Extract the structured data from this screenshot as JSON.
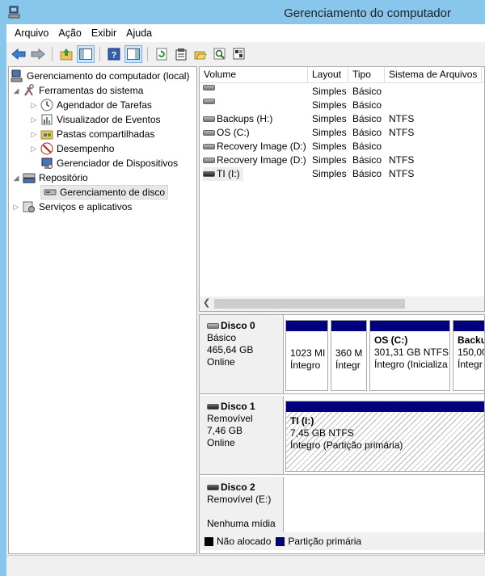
{
  "window": {
    "title": "Gerenciamento do computador"
  },
  "menu": [
    "Arquivo",
    "Ação",
    "Exibir",
    "Ajuda"
  ],
  "toolbar": {
    "icons": [
      "back-arrow-icon",
      "forward-arrow-icon",
      "up-folder-icon",
      "show-hide-tree-icon",
      "help-icon",
      "properties-pane-icon",
      "refresh-icon",
      "properties-icon",
      "open-icon",
      "search-icon",
      "settings-icon"
    ]
  },
  "tree": {
    "root": "Gerenciamento do computador (local)",
    "tools": "Ferramentas do sistema",
    "scheduler": "Agendador de Tarefas",
    "events": "Visualizador de Eventos",
    "shared": "Pastas compartilhadas",
    "performance": "Desempenho",
    "devices": "Gerenciador de Dispositivos",
    "storage": "Repositório",
    "diskmgmt": "Gerenciamento de disco",
    "services": "Serviços e aplicativos"
  },
  "volumes": {
    "columns": [
      "Volume",
      "Layout",
      "Tipo",
      "Sistema de Arquivos"
    ],
    "rows": [
      {
        "volume": "",
        "layout": "Simples",
        "type": "Básico",
        "fs": ""
      },
      {
        "volume": "",
        "layout": "Simples",
        "type": "Básico",
        "fs": ""
      },
      {
        "volume": "Backups (H:)",
        "layout": "Simples",
        "type": "Básico",
        "fs": "NTFS"
      },
      {
        "volume": "OS (C:)",
        "layout": "Simples",
        "type": "Básico",
        "fs": "NTFS"
      },
      {
        "volume": "Recovery Image (D:)",
        "layout": "Simples",
        "type": "Básico",
        "fs": ""
      },
      {
        "volume": "Recovery Image (D:)",
        "layout": "Simples",
        "type": "Básico",
        "fs": "NTFS"
      },
      {
        "volume": "TI (I:)",
        "layout": "Simples",
        "type": "Básico",
        "fs": "NTFS"
      }
    ]
  },
  "disks": {
    "disk0": {
      "name": "Disco 0",
      "type": "Básico",
      "size": "465,64 GB",
      "status": "Online",
      "p1": {
        "size": "1023 MI",
        "status": "Íntegro"
      },
      "p2": {
        "size": "360 M",
        "status": "Íntegr"
      },
      "p3": {
        "name": "OS  (C:)",
        "size": "301,31 GB NTFS",
        "status": "Íntegro (Inicializa"
      },
      "p4": {
        "name": "Backu",
        "size": "150,00",
        "status": "Íntegr"
      }
    },
    "disk1": {
      "name": "Disco 1",
      "type": "Removível",
      "size": "7,46 GB",
      "status": "Online",
      "p1": {
        "name": "TI  (I:)",
        "size": "7,45 GB NTFS",
        "status": "Íntegro (Partição primária)"
      }
    },
    "disk2": {
      "name": "Disco 2",
      "type": "Removível (E:)",
      "status": "Nenhuma mídia"
    }
  },
  "legend": {
    "unallocated": "Não alocado",
    "primary": "Partição primária",
    "unallocated_color": "#000000",
    "primary_color": "#00007e"
  }
}
